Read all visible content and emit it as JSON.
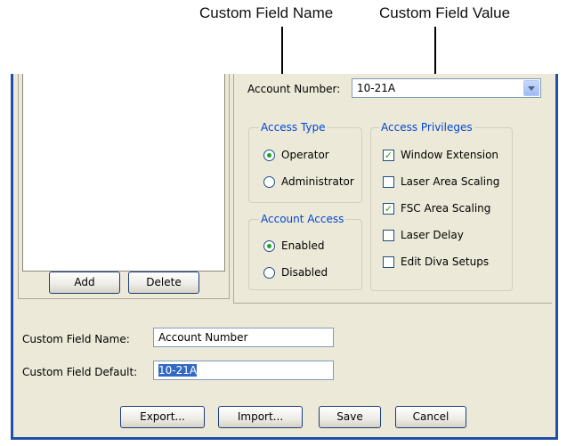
{
  "callouts": {
    "name_label": "Custom Field Name",
    "value_label": "Custom Field Value"
  },
  "account": {
    "label": "Account Number:",
    "value": "10-21A"
  },
  "access_type": {
    "title": "Access Type",
    "options": [
      "Operator",
      "Administrator"
    ],
    "selected": "Operator"
  },
  "account_access": {
    "title": "Account Access",
    "options": [
      "Enabled",
      "Disabled"
    ],
    "selected": "Enabled"
  },
  "access_privileges": {
    "title": "Access Privileges",
    "items": [
      {
        "label": "Window Extension",
        "checked": true
      },
      {
        "label": "Laser Area Scaling",
        "checked": false
      },
      {
        "label": "FSC Area Scaling",
        "checked": true
      },
      {
        "label": "Laser Delay",
        "checked": false
      },
      {
        "label": "Edit Diva Setups",
        "checked": false
      }
    ]
  },
  "list_buttons": {
    "add": "Add",
    "delete": "Delete"
  },
  "custom_field": {
    "name_label": "Custom Field Name:",
    "name_value": "Account Number",
    "default_label": "Custom Field Default:",
    "default_value": "10-21A"
  },
  "footer": {
    "export": "Export...",
    "import": "Import...",
    "save": "Save",
    "cancel": "Cancel"
  },
  "colors": {
    "window_bg": "#ece9d8",
    "frame_border": "#1f4fa8",
    "group_title": "#0046d5",
    "check_mark": "#21a121",
    "selection": "#316ac5"
  }
}
